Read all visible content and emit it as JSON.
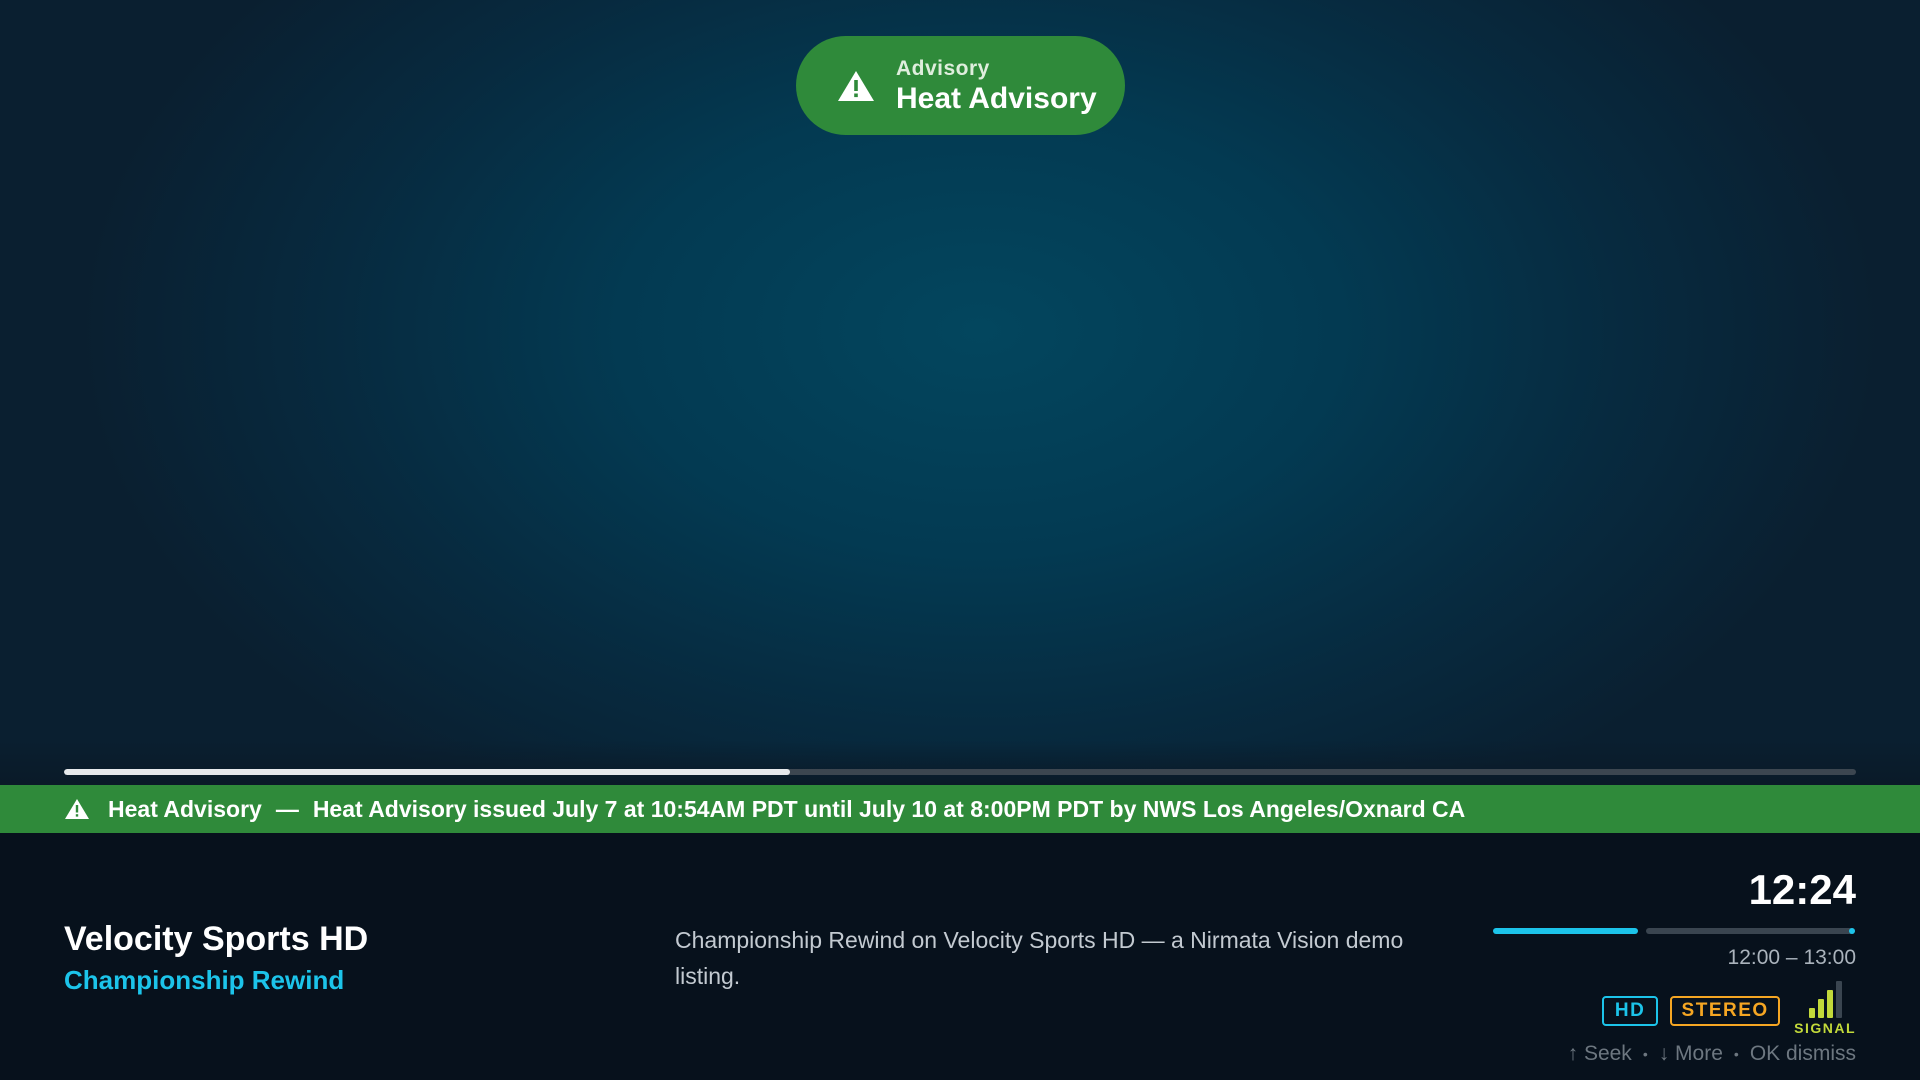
{
  "alert": {
    "kicker": "Advisory",
    "title": "Heat Advisory",
    "icon": "warning-triangle-icon",
    "color": "#2f8a3a"
  },
  "seek": {
    "progress": 0.405
  },
  "ticker": {
    "title": "Heat Advisory",
    "separator": "—",
    "message": "Heat Advisory issued July 7 at 10:54AM PDT until July 10 at 8:00PM PDT by NWS Los Angeles/Oxnard CA"
  },
  "channel": {
    "name": "Velocity Sports HD",
    "program": "Championship Rewind",
    "description": "Championship Rewind on Velocity Sports HD — a Nirmata Vision demo listing."
  },
  "schedule": {
    "clock": "12:24",
    "time_range": "12:00 – 13:00",
    "progress": 0.4
  },
  "badges": {
    "hd": "HD",
    "stereo": "STEREO",
    "signal_label": "SIGNAL",
    "signal_level": 3,
    "signal_max": 4
  },
  "hints": {
    "seek": "↑ Seek",
    "more": "↓ More",
    "dismiss": "OK dismiss",
    "separator": "•"
  },
  "colors": {
    "accent": "#1cc4ea",
    "alert_green": "#2f8a3a",
    "stereo": "#f5a623",
    "signal": "#c2d93a"
  }
}
